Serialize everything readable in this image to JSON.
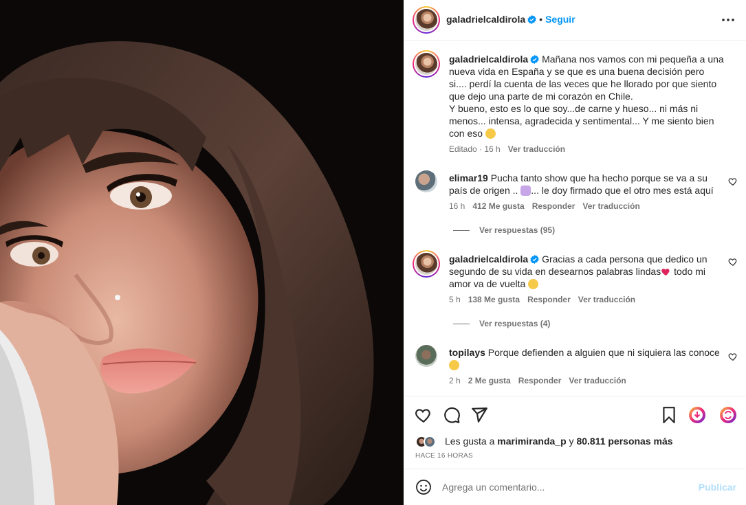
{
  "post": {
    "author": "galadrielcaldirola",
    "follow_label": "Seguir",
    "separator": "•"
  },
  "caption": {
    "author": "galadrielcaldirola",
    "text": "Mañana nos vamos con mi pequeña a una nueva vida en España y se que es una buena decisión pero si.... perdí la cuenta de las veces que he llorado por que siento que dejo una parte de mi corazón en Chile.",
    "text2": "Y bueno, esto es lo que soy...de carne y hueso... ni más ni menos... intensa, agradecida y sentimental... Y me siento bien con eso",
    "edited": "Editado · 16 h",
    "translate": "Ver traducción"
  },
  "comments": [
    {
      "author": "elimar19",
      "text_a": "Pucha tanto show que ha hecho porque se va a su país de origen ..",
      "text_b": "... le doy firmado que el otro mes está aquí",
      "time": "16 h",
      "likes": "412 Me gusta",
      "reply": "Responder",
      "translate": "Ver traducción",
      "replies": "Ver respuestas (95)"
    },
    {
      "author": "galadrielcaldirola",
      "text_a": "Gracias a cada persona que dedico un segundo de su vida en desearnos palabras lindas",
      "text_b": " todo mi amor va de vuelta",
      "time": "5 h",
      "likes": "138 Me gusta",
      "reply": "Responder",
      "translate": "Ver traducción",
      "replies": "Ver respuestas (4)"
    },
    {
      "author": "topilays",
      "text_a": "Porque defienden a alguien que ni siquiera las conoce",
      "time": "2 h",
      "likes": "2 Me gusta",
      "reply": "Responder",
      "translate": "Ver traducción"
    }
  ],
  "likes_line": {
    "prefix": "Les gusta a",
    "user": "marimiranda_p",
    "middle": "y",
    "count": "80.811 personas más"
  },
  "timestamp": "HACE 16 HORAS",
  "add_comment": {
    "placeholder": "Agrega un comentario...",
    "post_label": "Publicar"
  },
  "colors": {
    "accent": "#0095f6",
    "verified": "#0095f6",
    "muted": "#737373",
    "post_disabled": "#b2dffc"
  }
}
